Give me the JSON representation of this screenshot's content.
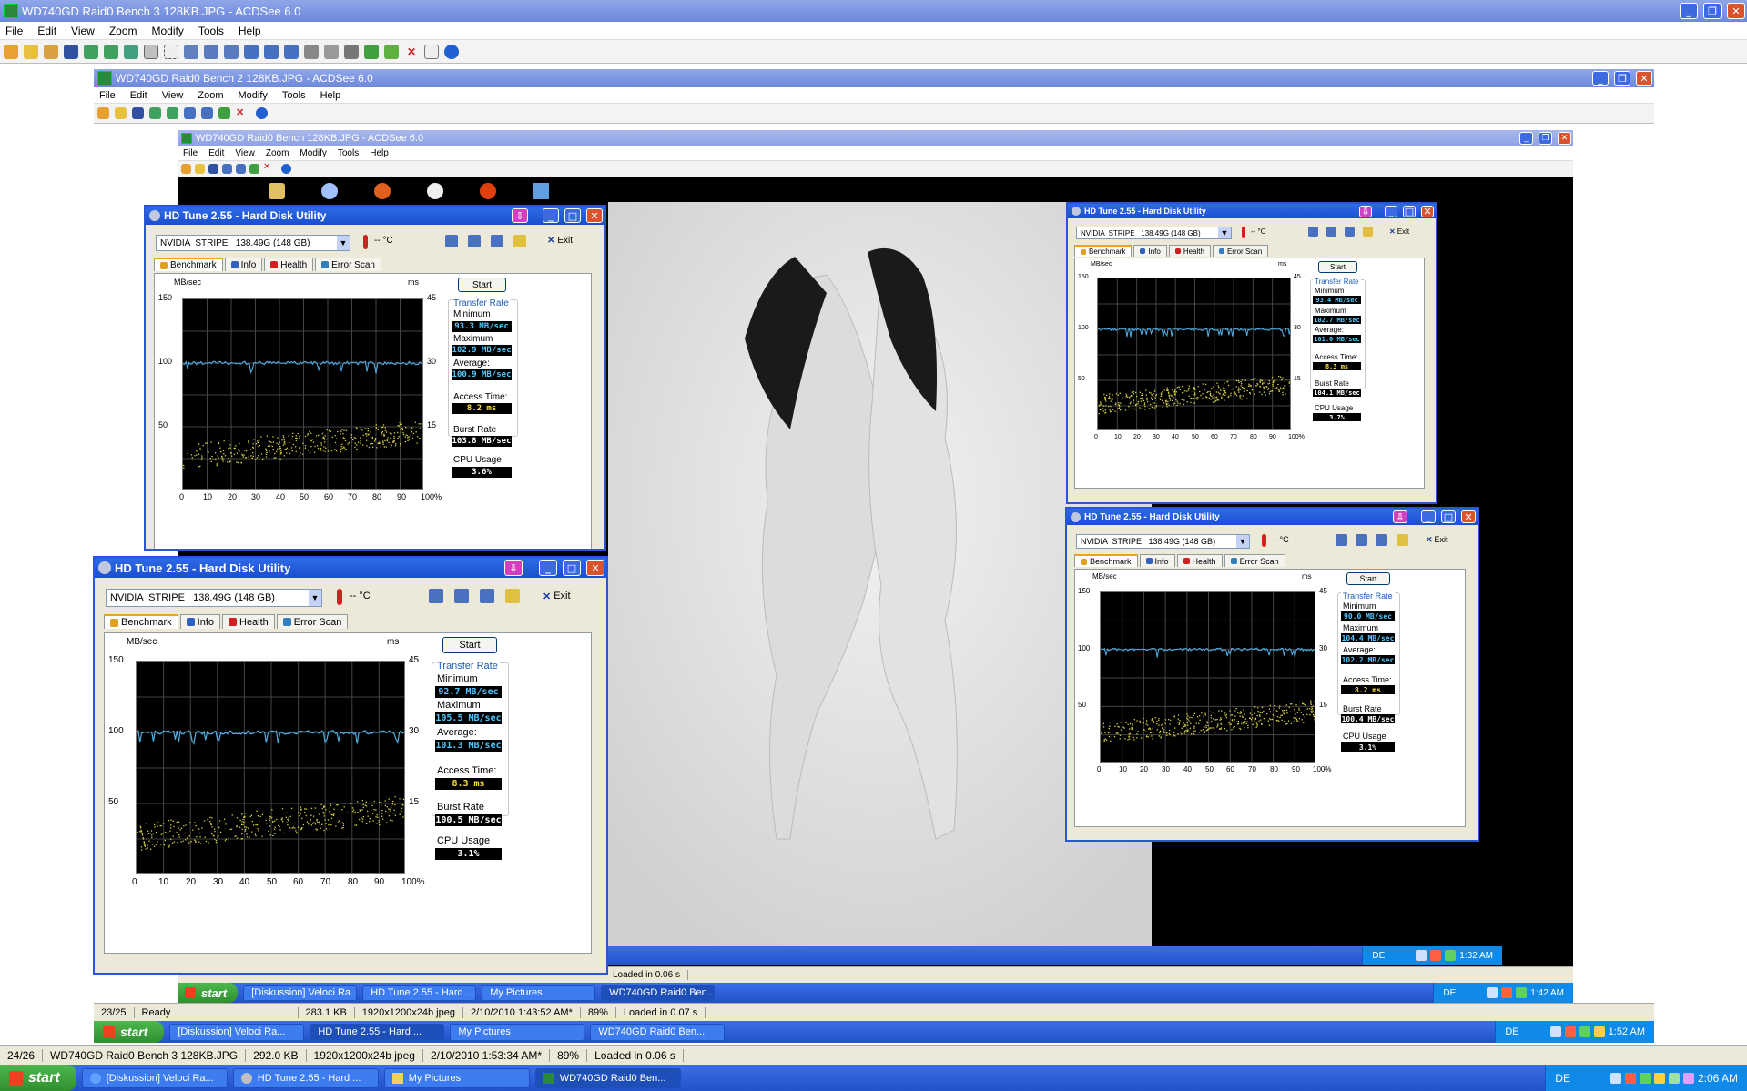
{
  "outer": {
    "title": "WD740GD Raid0 Bench 3 128KB.JPG - ACDSee 6.0",
    "menu": [
      "File",
      "Edit",
      "View",
      "Zoom",
      "Modify",
      "Tools",
      "Help"
    ],
    "status": {
      "pos": "24/26",
      "file": "WD740GD Raid0 Bench 3 128KB.JPG",
      "size": "292.0 KB",
      "dims": "1920x1200x24b jpeg",
      "date": "2/10/2010 1:53:34 AM*",
      "zoom": "89%",
      "loaded": "Loaded in 0.06 s"
    }
  },
  "mid": {
    "title": "WD740GD Raid0 Bench 2 128KB.JPG - ACDSee 6.0",
    "status": {
      "pos": "23/25",
      "state": "Ready",
      "size": "283.1 KB",
      "dims": "1920x1200x24b jpeg",
      "date": "2/10/2010 1:43:52 AM*",
      "zoom": "89%",
      "loaded": "Loaded in 0.07 s"
    },
    "loaded_inner": "Loaded in 0.06 s"
  },
  "inner": {
    "title": "WD740GD Raid0 Bench 128KB.JPG - ACDSee 6.0"
  },
  "taskbars": {
    "main": {
      "start": "start",
      "tasks": [
        "[Diskussion] Veloci Ra...",
        "HD Tune 2.55 - Hard ...",
        "My Pictures",
        "WD740GD Raid0 Ben..."
      ],
      "lang": "DE",
      "clock": "2:06 AM"
    },
    "mid": {
      "start": "start",
      "tasks": [
        "[Diskussion] Veloci Ra...",
        "HD Tune 2.55 - Hard ...",
        "My Pictures",
        "WD740GD Raid0 Ben..."
      ],
      "lang": "DE",
      "clock": "1:52 AM"
    },
    "inner": {
      "start": "start",
      "tasks": [
        "[Diskussion] Veloci Ra...",
        "HD Tune 2.55 - Hard ...",
        "My Pictures",
        "WD740GD Raid0 Ben..."
      ],
      "lang": "DE",
      "clock": "1:42 AM"
    },
    "deep": {
      "lang": "DE",
      "clock": "1:32 AM"
    }
  },
  "hdtune_common": {
    "title": "HD Tune 2.55 - Hard Disk Utility",
    "drive": "NVIDIA  STRIPE   138.49G (148 GB)",
    "temp": "-- °C",
    "exit": "Exit",
    "tabs": [
      "Benchmark",
      "Info",
      "Health",
      "Error Scan"
    ],
    "start": "Start",
    "transfer_rate": "Transfer Rate",
    "min_label": "Minimum",
    "max_label": "Maximum",
    "avg_label": "Average:",
    "access_label": "Access Time:",
    "burst_label": "Burst Rate",
    "cpu_label": "CPU Usage",
    "yunit": "MB/sec",
    "y2unit": "ms",
    "yticks": [
      "150",
      "100",
      "50"
    ],
    "y2ticks": [
      "45",
      "30",
      "15"
    ],
    "xticks": [
      "0",
      "10",
      "20",
      "30",
      "40",
      "50",
      "60",
      "70",
      "80",
      "90",
      "100%"
    ]
  },
  "hdtune": [
    {
      "id": "a",
      "min": "93.3 MB/sec",
      "max": "102.9 MB/sec",
      "avg": "100.9 MB/sec",
      "access": "8.2 ms",
      "burst": "103.8 MB/sec",
      "cpu": "3.6%"
    },
    {
      "id": "b",
      "min": "92.7 MB/sec",
      "max": "105.5 MB/sec",
      "avg": "101.3 MB/sec",
      "access": "8.3 ms",
      "burst": "100.5 MB/sec",
      "cpu": "3.1%"
    },
    {
      "id": "c",
      "min": "93.4 MB/sec",
      "max": "102.7 MB/sec",
      "avg": "101.0 MB/sec",
      "access": "8.3 ms",
      "burst": "104.1 MB/sec",
      "cpu": "3.7%"
    },
    {
      "id": "d",
      "min": "90.0 MB/sec",
      "max": "104.4 MB/sec",
      "avg": "102.2 MB/sec",
      "access": "8.2 ms",
      "burst": "100.4 MB/sec",
      "cpu": "3.1%"
    }
  ]
}
